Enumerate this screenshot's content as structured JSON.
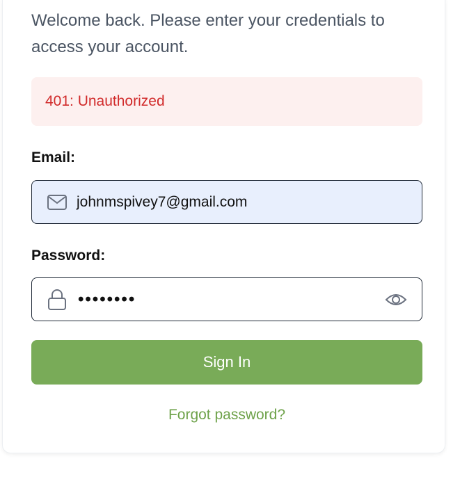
{
  "intro": {
    "text": "Welcome back. Please enter your credentials to access your account."
  },
  "alert": {
    "message": "401: Unauthorized",
    "text_color": "#d12b2b",
    "background": "#fdf0ef"
  },
  "email": {
    "label": "Email:",
    "value": "johnmspivey7@gmail.com",
    "icon": "mail-icon"
  },
  "password": {
    "label": "Password:",
    "masked_value": "••••••••",
    "icon": "lock-icon",
    "toggle_icon": "eye-icon"
  },
  "actions": {
    "sign_in_label": "Sign In",
    "forgot_label": "Forgot password?",
    "accent_color": "#79ab58"
  }
}
